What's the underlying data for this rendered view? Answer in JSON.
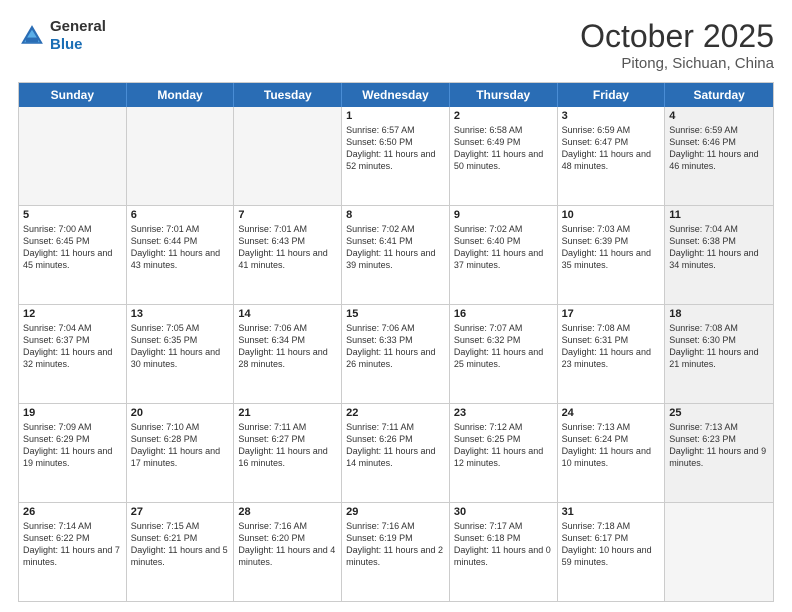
{
  "logo": {
    "line1": "General",
    "line2": "Blue"
  },
  "title": "October 2025",
  "subtitle": "Pitong, Sichuan, China",
  "headers": [
    "Sunday",
    "Monday",
    "Tuesday",
    "Wednesday",
    "Thursday",
    "Friday",
    "Saturday"
  ],
  "rows": [
    [
      {
        "day": "",
        "text": "",
        "empty": true
      },
      {
        "day": "",
        "text": "",
        "empty": true
      },
      {
        "day": "",
        "text": "",
        "empty": true
      },
      {
        "day": "1",
        "text": "Sunrise: 6:57 AM\nSunset: 6:50 PM\nDaylight: 11 hours and 52 minutes.",
        "empty": false
      },
      {
        "day": "2",
        "text": "Sunrise: 6:58 AM\nSunset: 6:49 PM\nDaylight: 11 hours and 50 minutes.",
        "empty": false
      },
      {
        "day": "3",
        "text": "Sunrise: 6:59 AM\nSunset: 6:47 PM\nDaylight: 11 hours and 48 minutes.",
        "empty": false
      },
      {
        "day": "4",
        "text": "Sunrise: 6:59 AM\nSunset: 6:46 PM\nDaylight: 11 hours and 46 minutes.",
        "empty": false,
        "shaded": true
      }
    ],
    [
      {
        "day": "5",
        "text": "Sunrise: 7:00 AM\nSunset: 6:45 PM\nDaylight: 11 hours and 45 minutes.",
        "empty": false
      },
      {
        "day": "6",
        "text": "Sunrise: 7:01 AM\nSunset: 6:44 PM\nDaylight: 11 hours and 43 minutes.",
        "empty": false
      },
      {
        "day": "7",
        "text": "Sunrise: 7:01 AM\nSunset: 6:43 PM\nDaylight: 11 hours and 41 minutes.",
        "empty": false
      },
      {
        "day": "8",
        "text": "Sunrise: 7:02 AM\nSunset: 6:41 PM\nDaylight: 11 hours and 39 minutes.",
        "empty": false
      },
      {
        "day": "9",
        "text": "Sunrise: 7:02 AM\nSunset: 6:40 PM\nDaylight: 11 hours and 37 minutes.",
        "empty": false
      },
      {
        "day": "10",
        "text": "Sunrise: 7:03 AM\nSunset: 6:39 PM\nDaylight: 11 hours and 35 minutes.",
        "empty": false
      },
      {
        "day": "11",
        "text": "Sunrise: 7:04 AM\nSunset: 6:38 PM\nDaylight: 11 hours and 34 minutes.",
        "empty": false,
        "shaded": true
      }
    ],
    [
      {
        "day": "12",
        "text": "Sunrise: 7:04 AM\nSunset: 6:37 PM\nDaylight: 11 hours and 32 minutes.",
        "empty": false
      },
      {
        "day": "13",
        "text": "Sunrise: 7:05 AM\nSunset: 6:35 PM\nDaylight: 11 hours and 30 minutes.",
        "empty": false
      },
      {
        "day": "14",
        "text": "Sunrise: 7:06 AM\nSunset: 6:34 PM\nDaylight: 11 hours and 28 minutes.",
        "empty": false
      },
      {
        "day": "15",
        "text": "Sunrise: 7:06 AM\nSunset: 6:33 PM\nDaylight: 11 hours and 26 minutes.",
        "empty": false
      },
      {
        "day": "16",
        "text": "Sunrise: 7:07 AM\nSunset: 6:32 PM\nDaylight: 11 hours and 25 minutes.",
        "empty": false
      },
      {
        "day": "17",
        "text": "Sunrise: 7:08 AM\nSunset: 6:31 PM\nDaylight: 11 hours and 23 minutes.",
        "empty": false
      },
      {
        "day": "18",
        "text": "Sunrise: 7:08 AM\nSunset: 6:30 PM\nDaylight: 11 hours and 21 minutes.",
        "empty": false,
        "shaded": true
      }
    ],
    [
      {
        "day": "19",
        "text": "Sunrise: 7:09 AM\nSunset: 6:29 PM\nDaylight: 11 hours and 19 minutes.",
        "empty": false
      },
      {
        "day": "20",
        "text": "Sunrise: 7:10 AM\nSunset: 6:28 PM\nDaylight: 11 hours and 17 minutes.",
        "empty": false
      },
      {
        "day": "21",
        "text": "Sunrise: 7:11 AM\nSunset: 6:27 PM\nDaylight: 11 hours and 16 minutes.",
        "empty": false
      },
      {
        "day": "22",
        "text": "Sunrise: 7:11 AM\nSunset: 6:26 PM\nDaylight: 11 hours and 14 minutes.",
        "empty": false
      },
      {
        "day": "23",
        "text": "Sunrise: 7:12 AM\nSunset: 6:25 PM\nDaylight: 11 hours and 12 minutes.",
        "empty": false
      },
      {
        "day": "24",
        "text": "Sunrise: 7:13 AM\nSunset: 6:24 PM\nDaylight: 11 hours and 10 minutes.",
        "empty": false
      },
      {
        "day": "25",
        "text": "Sunrise: 7:13 AM\nSunset: 6:23 PM\nDaylight: 11 hours and 9 minutes.",
        "empty": false,
        "shaded": true
      }
    ],
    [
      {
        "day": "26",
        "text": "Sunrise: 7:14 AM\nSunset: 6:22 PM\nDaylight: 11 hours and 7 minutes.",
        "empty": false
      },
      {
        "day": "27",
        "text": "Sunrise: 7:15 AM\nSunset: 6:21 PM\nDaylight: 11 hours and 5 minutes.",
        "empty": false
      },
      {
        "day": "28",
        "text": "Sunrise: 7:16 AM\nSunset: 6:20 PM\nDaylight: 11 hours and 4 minutes.",
        "empty": false
      },
      {
        "day": "29",
        "text": "Sunrise: 7:16 AM\nSunset: 6:19 PM\nDaylight: 11 hours and 2 minutes.",
        "empty": false
      },
      {
        "day": "30",
        "text": "Sunrise: 7:17 AM\nSunset: 6:18 PM\nDaylight: 11 hours and 0 minutes.",
        "empty": false
      },
      {
        "day": "31",
        "text": "Sunrise: 7:18 AM\nSunset: 6:17 PM\nDaylight: 10 hours and 59 minutes.",
        "empty": false
      },
      {
        "day": "",
        "text": "",
        "empty": true,
        "shaded": true
      }
    ]
  ]
}
